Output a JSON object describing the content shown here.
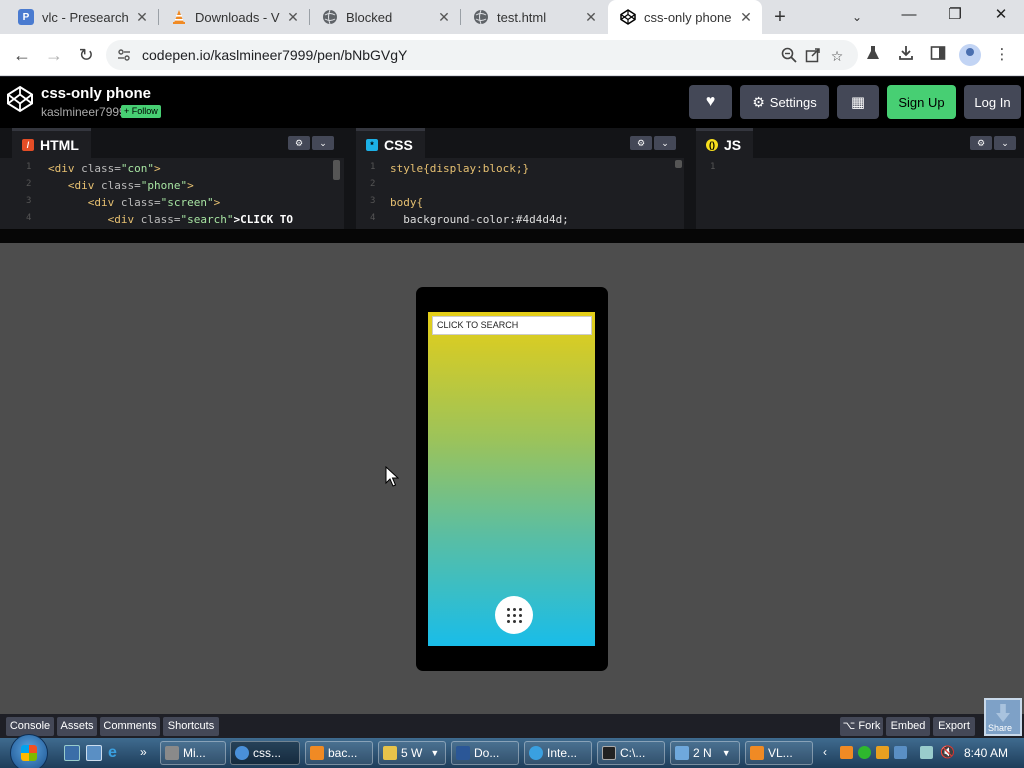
{
  "browser": {
    "tabs": [
      {
        "title": "vlc - Presearch",
        "icon": "presearch-icon",
        "color": "#4a7bd0",
        "active": false
      },
      {
        "title": "Downloads - V",
        "icon": "vlc-cone-icon",
        "color": "#f08a24",
        "active": false
      },
      {
        "title": "Blocked",
        "icon": "globe-icon",
        "color": "#5f6368",
        "active": false
      },
      {
        "title": "test.html",
        "icon": "globe-icon",
        "color": "#5f6368",
        "active": false
      },
      {
        "title": "css-only phone",
        "icon": "codepen-icon",
        "color": "#000000",
        "active": true
      }
    ],
    "new_tab": "+",
    "tab_search": "⌄",
    "window": {
      "minimize": "—",
      "restore": "❐",
      "close": "✕"
    },
    "url": "codepen.io/kaslmineer7999/pen/bNbGVgY"
  },
  "codepen": {
    "title": "css-only phone",
    "author": "kaslmineer7999",
    "follow": "+ Follow",
    "buttons": {
      "like": "♥",
      "settings": "Settings",
      "layout": "▦",
      "signup": "Sign Up",
      "login": "Log In"
    },
    "panels": {
      "html": {
        "label": "HTML",
        "lines": [
          {
            "indent": "",
            "tag": "<div",
            "attr": " class=",
            "str": "\"con\"",
            "end": ">"
          },
          {
            "indent": "   ",
            "tag": "<div",
            "attr": " class=",
            "str": "\"phone\"",
            "end": ">"
          },
          {
            "indent": "      ",
            "tag": "<div",
            "attr": " class=",
            "str": "\"screen\"",
            "end": ">"
          },
          {
            "indent": "         ",
            "tag": "<div",
            "attr": " class=",
            "str": "\"search\"",
            "end": ">CLICK TO"
          }
        ]
      },
      "css": {
        "label": "CSS",
        "lines": [
          "style{display:block;}",
          "",
          "body{",
          "  background-color:#4d4d4d;"
        ]
      },
      "js": {
        "label": "JS"
      }
    },
    "preview": {
      "search_text": "CLICK TO SEARCH",
      "colors": {
        "bg": "#4d4d4d",
        "top": "#e5ce18",
        "bottom": "#19bde9"
      }
    },
    "footer": {
      "left": [
        "Console",
        "Assets",
        "Comments",
        "Shortcuts"
      ],
      "right": [
        "⌥ Fork",
        "Embed",
        "Export"
      ],
      "share": "Share"
    }
  },
  "taskbar": {
    "items": [
      {
        "label": "Mi...",
        "color": "#8a8a8a"
      },
      {
        "label": "css...",
        "color": "#4a90d9"
      },
      {
        "label": "bac...",
        "color": "#f08a24"
      },
      {
        "label": "5 W",
        "color": "#e7c34a"
      },
      {
        "label": "Do...",
        "color": "#2b5797"
      },
      {
        "label": "Inte...",
        "color": "#3aa0e0"
      },
      {
        "label": "C:\\...",
        "color": "#222222"
      },
      {
        "label": "2 N",
        "color": "#6fa8dc"
      },
      {
        "label": "VL...",
        "color": "#f08a24"
      }
    ],
    "time": "8:40 AM"
  }
}
